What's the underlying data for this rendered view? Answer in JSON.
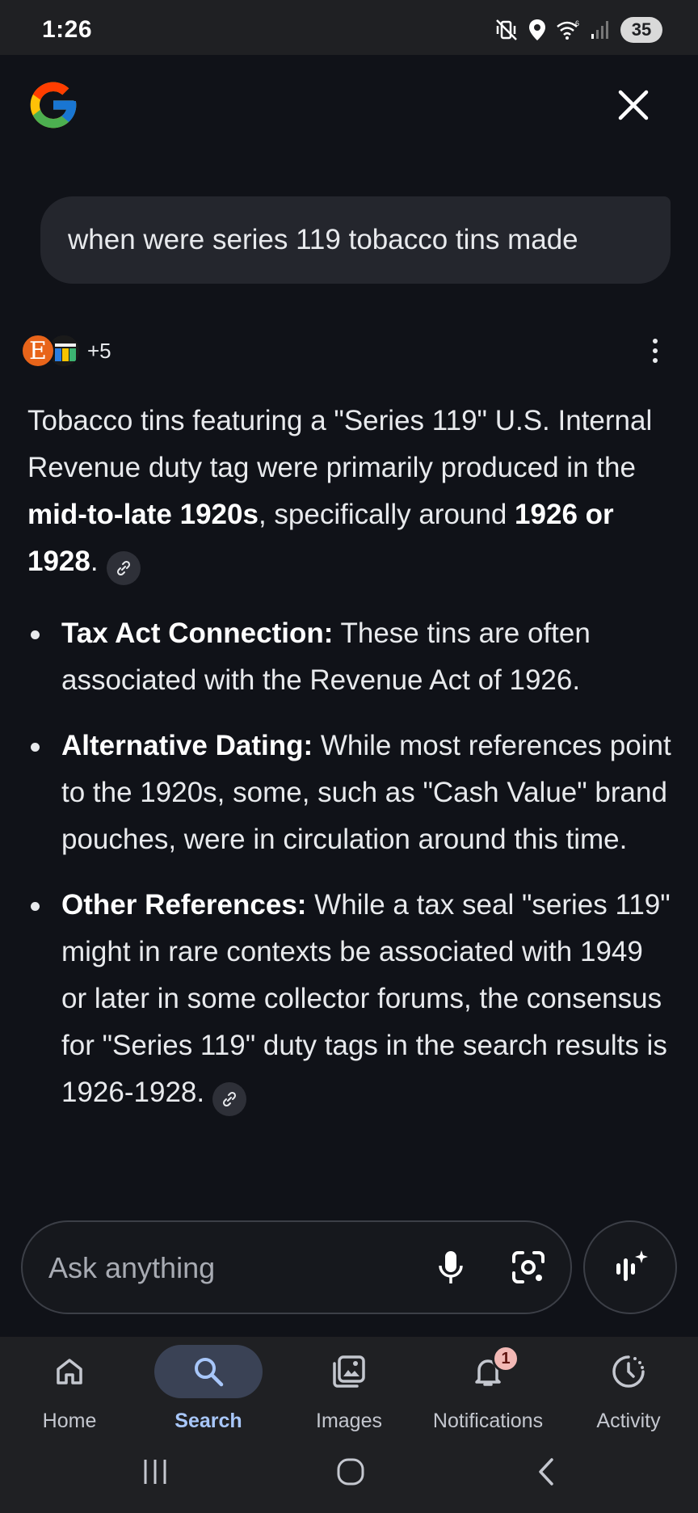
{
  "status_bar": {
    "time": "1:26",
    "battery": "35",
    "icons": [
      "mute-vibrate-icon",
      "location-icon",
      "wifi-6-icon",
      "signal-icon",
      "battery-icon"
    ]
  },
  "header": {
    "logo": "google-g-logo",
    "close_icon": "close-icon"
  },
  "query": {
    "text": "when were series 119 tobacco tins made"
  },
  "sources": {
    "first_letter": "E",
    "more_count": "+5"
  },
  "answer": {
    "intro_parts": [
      "Tobacco tins featuring a \"Series 119\" U.S. Internal Revenue duty tag were primarily produced in the ",
      "mid-to-late 1920s",
      ", specifically around ",
      "1926 or 1928",
      "."
    ],
    "bullets": [
      {
        "title": "Tax Act Connection:",
        "text": " These tins are often associated with the Revenue Act of 1926."
      },
      {
        "title": "Alternative Dating:",
        "text": " While most references point to the 1920s, some, such as \"Cash Value\" brand pouches, were in circulation around this time."
      },
      {
        "title": "Other References:",
        "text": " While a tax seal \"series 119\" might in rare contexts be associated with 1949 or later in some collector forums, the consensus for \"Series 119\" duty tags in the search results is 1926-1928."
      }
    ]
  },
  "ask_bar": {
    "placeholder": "Ask anything",
    "mic_icon": "microphone-icon",
    "lens_icon": "camera-lens-icon",
    "ai_icon": "ai-mode-sparkle-icon"
  },
  "bottom_nav": {
    "items": [
      {
        "label": "Home",
        "icon": "home-icon",
        "active": false
      },
      {
        "label": "Search",
        "icon": "search-icon",
        "active": true
      },
      {
        "label": "Images",
        "icon": "images-icon",
        "active": false
      },
      {
        "label": "Notifications",
        "icon": "bell-icon",
        "active": false,
        "badge": "1"
      },
      {
        "label": "Activity",
        "icon": "activity-clock-icon",
        "active": false
      }
    ]
  },
  "colors": {
    "background": "#101218",
    "bar": "#1f2023",
    "active_accent": "#a8c7fa",
    "active_pill": "#3a4255",
    "badge": "#f2b8b5"
  }
}
